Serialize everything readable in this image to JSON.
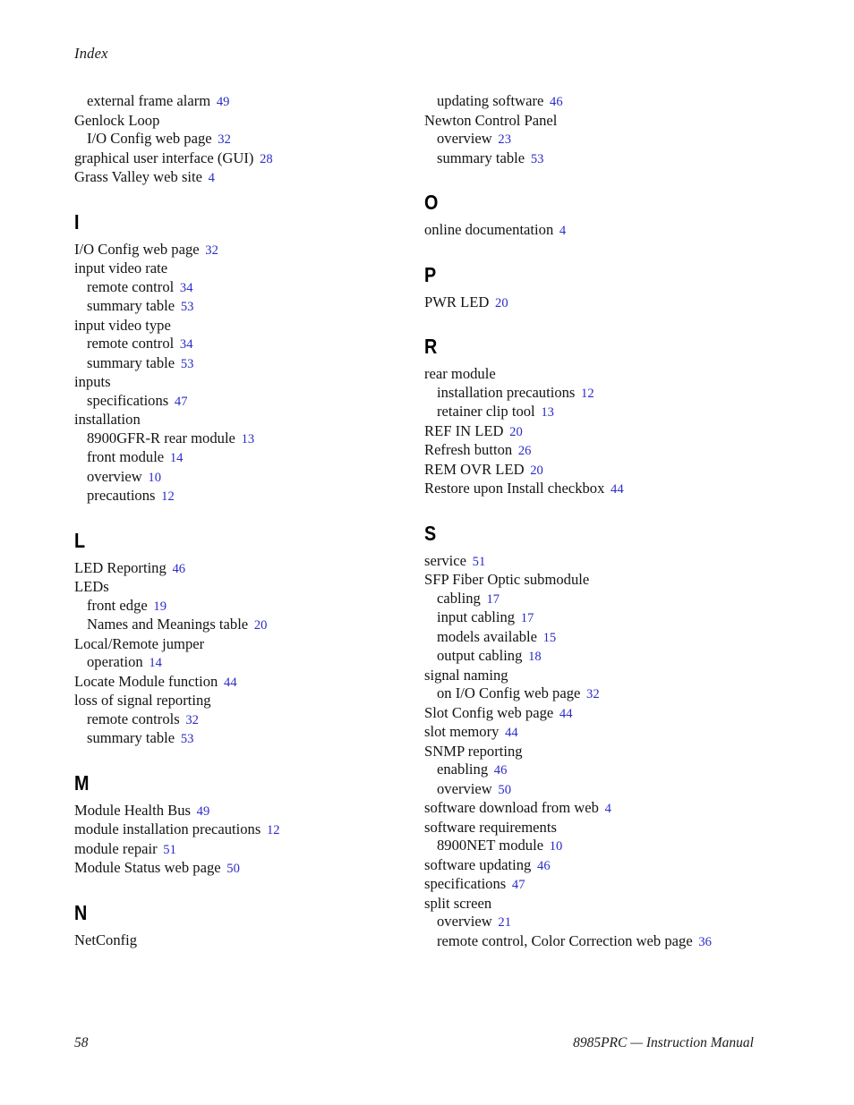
{
  "document": {
    "running_head": "Index",
    "footer_page_number": "58",
    "footer_manual": "8985PRC  —  Instruction Manual",
    "page_number_color": "#2b2bc8",
    "text_color": "#141414"
  },
  "columns": {
    "left": {
      "blocks": [
        {
          "type": "entries",
          "entries": [
            {
              "level": 2,
              "text": "external frame alarm",
              "page": "49"
            },
            {
              "level": 1,
              "text": "Genlock Loop",
              "page": ""
            },
            {
              "level": 2,
              "text": "I/O Config web page",
              "page": "32"
            },
            {
              "level": 1,
              "text": "graphical user interface (GUI)",
              "page": "28"
            },
            {
              "level": 1,
              "text": "Grass Valley web site",
              "page": "4"
            }
          ]
        },
        {
          "type": "section",
          "letter": "I",
          "entries": [
            {
              "level": 1,
              "text": "I/O Config web page",
              "page": "32"
            },
            {
              "level": 1,
              "text": "input video rate",
              "page": ""
            },
            {
              "level": 2,
              "text": "remote control",
              "page": "34"
            },
            {
              "level": 2,
              "text": "summary table",
              "page": "53"
            },
            {
              "level": 1,
              "text": "input video type",
              "page": ""
            },
            {
              "level": 2,
              "text": "remote control",
              "page": "34"
            },
            {
              "level": 2,
              "text": "summary table",
              "page": "53"
            },
            {
              "level": 1,
              "text": "inputs",
              "page": ""
            },
            {
              "level": 2,
              "text": "specifications",
              "page": "47"
            },
            {
              "level": 1,
              "text": "installation",
              "page": ""
            },
            {
              "level": 2,
              "text": "8900GFR-R rear module",
              "page": "13"
            },
            {
              "level": 2,
              "text": "front module",
              "page": "14"
            },
            {
              "level": 2,
              "text": "overview",
              "page": "10"
            },
            {
              "level": 2,
              "text": "precautions",
              "page": "12"
            }
          ]
        },
        {
          "type": "section",
          "letter": "L",
          "entries": [
            {
              "level": 1,
              "text": "LED Reporting",
              "page": "46"
            },
            {
              "level": 1,
              "text": "LEDs",
              "page": ""
            },
            {
              "level": 2,
              "text": "front edge",
              "page": "19"
            },
            {
              "level": 2,
              "text": "Names and Meanings table",
              "page": "20"
            },
            {
              "level": 1,
              "text": "Local/Remote jumper",
              "page": ""
            },
            {
              "level": 2,
              "text": "operation",
              "page": "14"
            },
            {
              "level": 1,
              "text": "Locate Module function",
              "page": "44"
            },
            {
              "level": 1,
              "text": "loss of signal reporting",
              "page": ""
            },
            {
              "level": 2,
              "text": "remote controls",
              "page": "32"
            },
            {
              "level": 2,
              "text": "summary table",
              "page": "53"
            }
          ]
        },
        {
          "type": "section",
          "letter": "M",
          "entries": [
            {
              "level": 1,
              "text": "Module Health Bus",
              "page": "49"
            },
            {
              "level": 1,
              "text": "module installation precautions",
              "page": "12"
            },
            {
              "level": 1,
              "text": "module repair",
              "page": "51"
            },
            {
              "level": 1,
              "text": "Module Status web page",
              "page": "50"
            }
          ]
        },
        {
          "type": "section",
          "letter": "N",
          "entries": [
            {
              "level": 1,
              "text": "NetConfig",
              "page": ""
            }
          ]
        }
      ]
    },
    "right": {
      "blocks": [
        {
          "type": "entries",
          "entries": [
            {
              "level": 2,
              "text": "updating software",
              "page": "46"
            },
            {
              "level": 1,
              "text": "Newton Control Panel",
              "page": ""
            },
            {
              "level": 2,
              "text": "overview",
              "page": "23"
            },
            {
              "level": 2,
              "text": "summary table",
              "page": "53"
            }
          ]
        },
        {
          "type": "section",
          "letter": "O",
          "entries": [
            {
              "level": 1,
              "text": "online documentation",
              "page": "4"
            }
          ]
        },
        {
          "type": "section",
          "letter": "P",
          "entries": [
            {
              "level": 1,
              "text": "PWR LED",
              "page": "20"
            }
          ]
        },
        {
          "type": "section",
          "letter": "R",
          "entries": [
            {
              "level": 1,
              "text": "rear module",
              "page": ""
            },
            {
              "level": 2,
              "text": "installation precautions",
              "page": "12"
            },
            {
              "level": 2,
              "text": "retainer clip tool",
              "page": "13"
            },
            {
              "level": 1,
              "text": "REF IN LED",
              "page": "20"
            },
            {
              "level": 1,
              "text": "Refresh button",
              "page": "26"
            },
            {
              "level": 1,
              "text": "REM OVR LED",
              "page": "20"
            },
            {
              "level": 1,
              "text": "Restore upon Install checkbox",
              "page": "44"
            }
          ]
        },
        {
          "type": "section",
          "letter": "S",
          "entries": [
            {
              "level": 1,
              "text": "service",
              "page": "51"
            },
            {
              "level": 1,
              "text": "SFP Fiber Optic submodule",
              "page": ""
            },
            {
              "level": 2,
              "text": "cabling",
              "page": "17"
            },
            {
              "level": 2,
              "text": "input cabling",
              "page": "17"
            },
            {
              "level": 2,
              "text": "models available",
              "page": "15"
            },
            {
              "level": 2,
              "text": "output cabling",
              "page": "18"
            },
            {
              "level": 1,
              "text": "signal naming",
              "page": ""
            },
            {
              "level": 2,
              "text": "on I/O Config web page",
              "page": "32"
            },
            {
              "level": 1,
              "text": "Slot Config web page",
              "page": "44"
            },
            {
              "level": 1,
              "text": "slot memory",
              "page": "44"
            },
            {
              "level": 1,
              "text": "SNMP reporting",
              "page": ""
            },
            {
              "level": 2,
              "text": "enabling",
              "page": "46"
            },
            {
              "level": 2,
              "text": "overview",
              "page": "50"
            },
            {
              "level": 1,
              "text": "software download from web",
              "page": "4"
            },
            {
              "level": 1,
              "text": "software requirements",
              "page": ""
            },
            {
              "level": 2,
              "text": "8900NET module",
              "page": "10"
            },
            {
              "level": 1,
              "text": "software updating",
              "page": "46"
            },
            {
              "level": 1,
              "text": "specifications",
              "page": "47"
            },
            {
              "level": 1,
              "text": "split screen",
              "page": ""
            },
            {
              "level": 2,
              "text": "overview",
              "page": "21"
            },
            {
              "level": 2,
              "text": "remote control, Color Correction web page",
              "page": "36"
            }
          ]
        }
      ]
    }
  }
}
